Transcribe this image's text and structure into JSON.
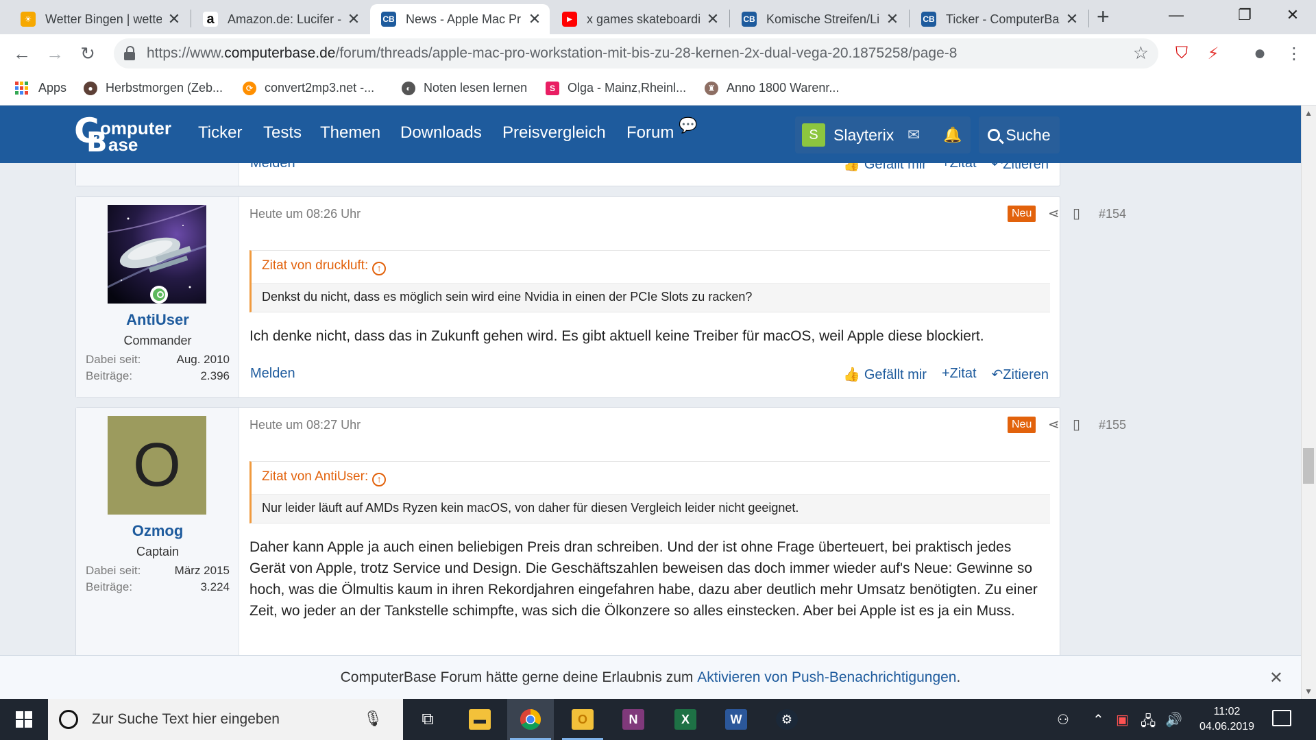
{
  "tabs": [
    {
      "title": "Wetter Bingen | wetter",
      "fav": "weather",
      "color": "#f6a800"
    },
    {
      "title": "Amazon.de: Lucifer - ",
      "fav": "a",
      "color": "#ffffff"
    },
    {
      "title": "News - Apple Mac Pr",
      "fav": "CB",
      "color": "#1e5b9d"
    },
    {
      "title": "x games skateboardi",
      "fav": "yt",
      "color": "#ff0000"
    },
    {
      "title": "Komische Streifen/Li",
      "fav": "CB",
      "color": "#1e5b9d"
    },
    {
      "title": "Ticker - ComputerBa",
      "fav": "CB",
      "color": "#1e5b9d"
    }
  ],
  "address": {
    "scheme": "https://www.",
    "domain": "computerbase.de",
    "path": "/forum/threads/apple-mac-pro-workstation-mit-bis-zu-28-kernen-2x-dual-vega-20.1875258/page-8"
  },
  "bookmarks": [
    {
      "label": "Apps"
    },
    {
      "label": "Herbstmorgen (Zeb..."
    },
    {
      "label": "convert2mp3.net -..."
    },
    {
      "label": "Noten lesen lernen"
    },
    {
      "label": "Olga - Mainz,Rheinl..."
    },
    {
      "label": "Anno 1800 Warenr..."
    }
  ],
  "site": {
    "logo_line1": "omputer",
    "logo_line2": "ase",
    "nav": [
      "Ticker",
      "Tests",
      "Themen",
      "Downloads",
      "Preisvergleich",
      "Forum"
    ],
    "user_initial": "S",
    "username": "Slayterix",
    "search_label": "Suche"
  },
  "prev_post_footer": {
    "melden": "Melden",
    "like": "Gefällt mir",
    "quote": "Zitat",
    "reply": "Zitieren"
  },
  "posts": [
    {
      "author": "AntiUser",
      "rank": "Commander",
      "joined_label": "Dabei seit:",
      "joined": "Aug. 2010",
      "posts_label": "Beiträge:",
      "post_count": "2.396",
      "time": "Heute um 08:26 Uhr",
      "badge": "Neu",
      "number": "#154",
      "quote_author": "Zitat von druckluft:",
      "quote_text": "Denkst du nicht, dass es möglich sein wird eine Nvidia in einen der PCIe Slots zu racken?",
      "text": "Ich denke nicht, dass das in Zukunft gehen wird. Es gibt aktuell keine Treiber für macOS, weil Apple diese blockiert.",
      "melden": "Melden",
      "like": "Gefällt mir",
      "quote": "Zitat",
      "reply": "Zitieren"
    },
    {
      "author": "Ozmog",
      "avatar_letter": "O",
      "rank": "Captain",
      "joined_label": "Dabei seit:",
      "joined": "März 2015",
      "posts_label": "Beiträge:",
      "post_count": "3.224",
      "time": "Heute um 08:27 Uhr",
      "badge": "Neu",
      "number": "#155",
      "quote_author": "Zitat von AntiUser:",
      "quote_text": "Nur leider läuft auf AMDs Ryzen kein macOS, von daher für diesen Vergleich leider nicht geeignet.",
      "text": "Daher kann Apple ja auch einen beliebigen Preis dran schreiben. Und der ist ohne Frage überteuert, bei praktisch jedes Gerät von Apple, trotz Service und Design. Die Geschäftszahlen beweisen das doch immer wieder auf's Neue: Gewinne so hoch, was die Ölmultis kaum in ihren Rekordjahren eingefahren habe, dazu aber deutlich mehr Umsatz benötigten. Zu einer Zeit, wo jeder an der Tankstelle schimpfte, was sich die Ölkonzere so alles einstecken. Aber bei Apple ist es ja ein Muss."
    }
  ],
  "push_banner": {
    "text": "ComputerBase Forum hätte gerne deine Erlaubnis zum ",
    "link": "Aktivieren von Push-Benachrichtigungen",
    "end": "."
  },
  "taskbar": {
    "search_placeholder": "Zur Suche Text hier eingeben",
    "time": "11:02",
    "date": "04.06.2019"
  }
}
